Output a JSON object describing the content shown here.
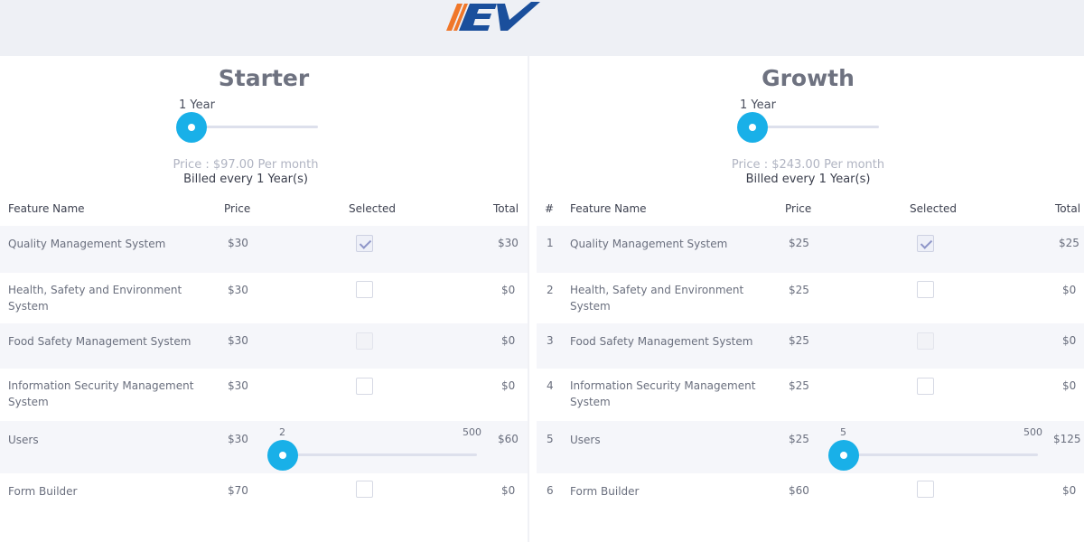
{
  "brand": {
    "logo_text": "EV",
    "logo_color": "#1a4f9c",
    "stripe_color": "#f0772a"
  },
  "colors": {
    "accent": "#19b0e8",
    "track": "#dde0ec",
    "row_shade": "#f5f6fa",
    "check": "#8e95c8"
  },
  "plans": [
    {
      "title": "Starter",
      "period": "1 Year",
      "price_text": "Price : $97.00 Per month",
      "billed_text": "Billed every 1 Year(s)",
      "headers": {
        "index": "",
        "feature": "Feature Name",
        "price": "Price",
        "selected": "Selected",
        "total": "Total"
      },
      "rows": [
        {
          "index": "",
          "feature": "Quality Management System",
          "price": "$30",
          "selected": true,
          "total": "$30"
        },
        {
          "index": "",
          "feature": "Health, Safety and Environment System",
          "price": "$30",
          "selected": false,
          "total": "$0"
        },
        {
          "index": "",
          "feature": "Food Safety Management System",
          "price": "$30",
          "selected": false,
          "total": "$0"
        },
        {
          "index": "",
          "feature": "Information Security Management System",
          "price": "$30",
          "selected": false,
          "total": "$0"
        },
        {
          "index": "",
          "feature": "Users",
          "price": "$30",
          "users_value": "2",
          "users_max": "500",
          "users_fraction": 0.0,
          "total": "$60"
        },
        {
          "index": "",
          "feature": "Form Builder",
          "price": "$70",
          "selected": false,
          "total": "$0"
        }
      ]
    },
    {
      "title": "Growth",
      "period": "1 Year",
      "price_text": "Price : $243.00 Per month",
      "billed_text": "Billed every 1 Year(s)",
      "headers": {
        "index": "#",
        "feature": "Feature Name",
        "price": "Price",
        "selected": "Selected",
        "total": "Total"
      },
      "rows": [
        {
          "index": "1",
          "feature": "Quality Management System",
          "price": "$25",
          "selected": true,
          "total": "$25"
        },
        {
          "index": "2",
          "feature": "Health, Safety and Environment System",
          "price": "$25",
          "selected": false,
          "total": "$0"
        },
        {
          "index": "3",
          "feature": "Food Safety Management System",
          "price": "$25",
          "selected": false,
          "total": "$0"
        },
        {
          "index": "4",
          "feature": "Information Security Management System",
          "price": "$25",
          "selected": false,
          "total": "$0"
        },
        {
          "index": "5",
          "feature": "Users",
          "price": "$25",
          "users_value": "5",
          "users_max": "500",
          "users_fraction": 0.0,
          "total": "$125"
        },
        {
          "index": "6",
          "feature": "Form Builder",
          "price": "$60",
          "selected": false,
          "total": "$0"
        }
      ]
    }
  ]
}
